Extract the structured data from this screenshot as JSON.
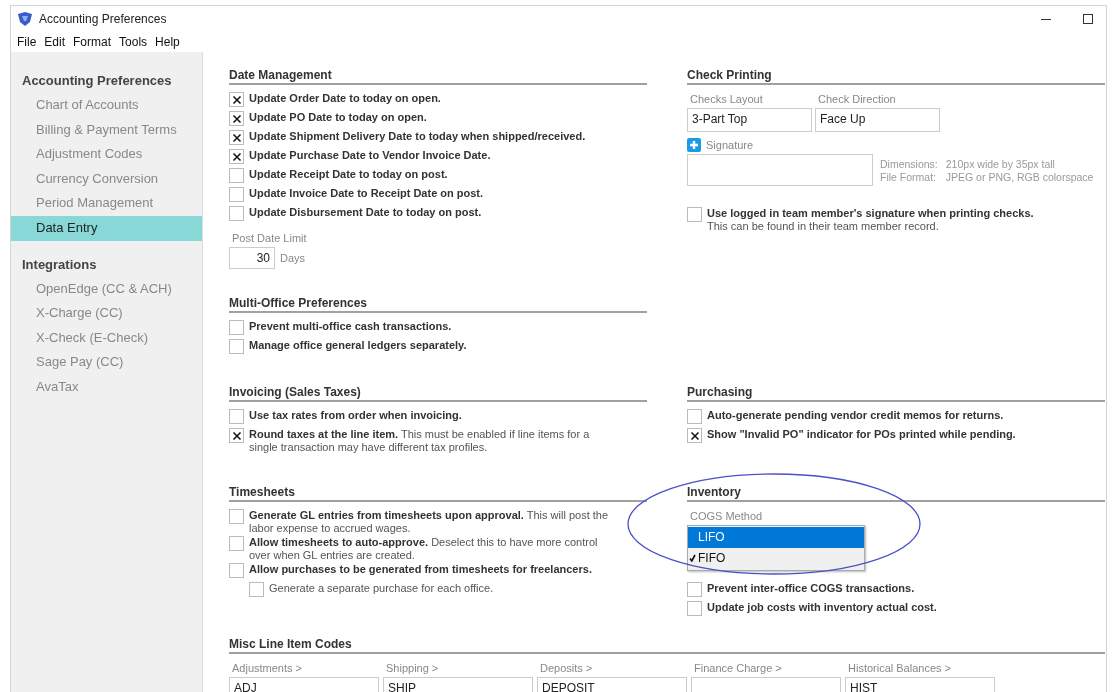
{
  "window": {
    "title": "Accounting Preferences"
  },
  "menu": [
    {
      "label": "File"
    },
    {
      "label": "Edit"
    },
    {
      "label": "Format"
    },
    {
      "label": "Tools"
    },
    {
      "label": "Help"
    }
  ],
  "sidebar": [
    {
      "heading": "Accounting Preferences",
      "items": [
        {
          "label": "Chart of Accounts",
          "selected": false
        },
        {
          "label": "Billing & Payment Terms",
          "selected": false
        },
        {
          "label": "Adjustment Codes",
          "selected": false
        },
        {
          "label": "Currency Conversion",
          "selected": false
        },
        {
          "label": "Period Management",
          "selected": false
        },
        {
          "label": "Data Entry",
          "selected": true
        }
      ]
    },
    {
      "heading": "Integrations",
      "items": [
        {
          "label": "OpenEdge (CC & ACH)",
          "selected": false
        },
        {
          "label": "X-Charge (CC)",
          "selected": false
        },
        {
          "label": "X-Check (E-Check)",
          "selected": false
        },
        {
          "label": "Sage Pay (CC)",
          "selected": false
        },
        {
          "label": "AvaTax",
          "selected": false
        }
      ]
    }
  ],
  "date_management": {
    "title": "Date Management",
    "options": [
      {
        "label": "Update Order Date to today on open.",
        "checked": true
      },
      {
        "label": "Update PO Date to today on open.",
        "checked": true
      },
      {
        "label": "Update Shipment Delivery Date to today when shipped/received.",
        "checked": true
      },
      {
        "label": "Update Purchase Date to Vendor Invoice Date.",
        "checked": true
      },
      {
        "label": "Update Receipt Date to today on post.",
        "checked": false
      },
      {
        "label": "Update Invoice Date to Receipt Date on post.",
        "checked": false
      },
      {
        "label": "Update Disbursement Date to today on post.",
        "checked": false
      }
    ],
    "post_date_limit": {
      "label": "Post Date Limit",
      "value": "30",
      "unit": "Days"
    }
  },
  "check_printing": {
    "title": "Check Printing",
    "fields": [
      {
        "label": "Checks Layout",
        "value": "3-Part Top"
      },
      {
        "label": "Check Direction",
        "value": "Face Up"
      }
    ],
    "signature": {
      "label": "Signature",
      "specs": [
        {
          "name": "Dimensions:",
          "value": "210px wide by 35px tall"
        },
        {
          "name": "File Format:",
          "value": "JPEG or PNG, RGB colorspace"
        }
      ]
    },
    "options": [
      {
        "label": "Use logged in team member's signature when printing checks.",
        "note": "This can be found in their team member record.",
        "checked": false
      }
    ]
  },
  "multi_office": {
    "title": "Multi-Office Preferences",
    "options": [
      {
        "label": "Prevent multi-office cash transactions.",
        "checked": false
      },
      {
        "label": "Manage office general ledgers separately.",
        "checked": false
      }
    ]
  },
  "invoicing": {
    "title": "Invoicing (Sales Taxes)",
    "options": [
      {
        "label": "**Use tax rates from order when invoicing.**",
        "checked": false
      },
      {
        "label": "**Round taxes at the line item.** This must be enabled if line items for a single transaction may have different tax profiles.",
        "checked": true
      }
    ]
  },
  "purchasing": {
    "title": "Purchasing",
    "options": [
      {
        "label": "Auto-generate pending vendor credit memos for returns.",
        "checked": false
      },
      {
        "label": "Show \"Invalid PO\" indicator for POs printed while pending.",
        "checked": true
      }
    ]
  },
  "timesheets": {
    "title": "Timesheets",
    "options": [
      {
        "label": "**Generate GL entries from timesheets upon approval.** This will post the labor expense to accrued wages.",
        "checked": false
      },
      {
        "label": "**Allow timesheets to auto-approve.** Deselect this to have more control over when GL entries are created.",
        "checked": false
      },
      {
        "label": "**Allow purchases to be generated from timesheets for freelancers.**",
        "checked": false,
        "children": [
          {
            "label": "Generate a separate purchase for each office.",
            "checked": false
          }
        ]
      }
    ]
  },
  "inventory": {
    "title": "Inventory",
    "cogs_method": {
      "label": "COGS Method",
      "options": [
        {
          "label": "LIFO",
          "selected": true,
          "checked": false
        },
        {
          "label": "FIFO",
          "selected": false,
          "checked": true
        }
      ]
    },
    "options": [
      {
        "label": "Prevent inter-office COGS transactions.",
        "checked": false
      },
      {
        "label": "Update job costs with inventory actual cost.",
        "checked": false
      }
    ]
  },
  "misc_line_item_codes": {
    "title": "Misc Line Item Codes",
    "fields": [
      {
        "label": "Adjustments >",
        "value": "ADJ"
      },
      {
        "label": "Shipping >",
        "value": "SHIP"
      },
      {
        "label": "Deposits >",
        "value": "DEPOSIT"
      },
      {
        "label": "Finance Charge >"
      },
      {
        "label": "Historical Balances >",
        "value": "HIST"
      }
    ]
  }
}
